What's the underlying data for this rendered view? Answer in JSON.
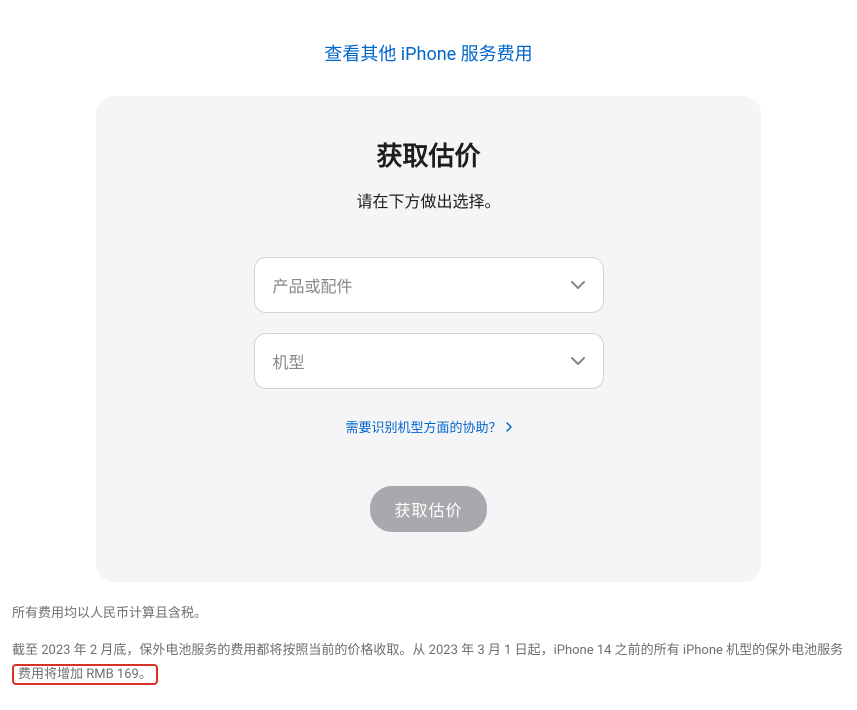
{
  "topLink": {
    "text": "查看其他 iPhone 服务费用"
  },
  "card": {
    "title": "获取估价",
    "subtitle": "请在下方做出选择。",
    "select1": {
      "placeholder": "产品或配件"
    },
    "select2": {
      "placeholder": "机型"
    },
    "helpLink": "需要识别机型方面的协助？",
    "button": "获取估价"
  },
  "footer": {
    "line1": "所有费用均以人民币计算且含税。",
    "line2_part1": "截至 2023 年 2 月底，保外电池服务的费用都将按照当前的价格收取。从 2023 年 3 月 1 日起，iPhone 14 之前的所有 iPhone 机型的保外电池服务",
    "line2_highlight": "费用将增加 RMB 169。"
  }
}
